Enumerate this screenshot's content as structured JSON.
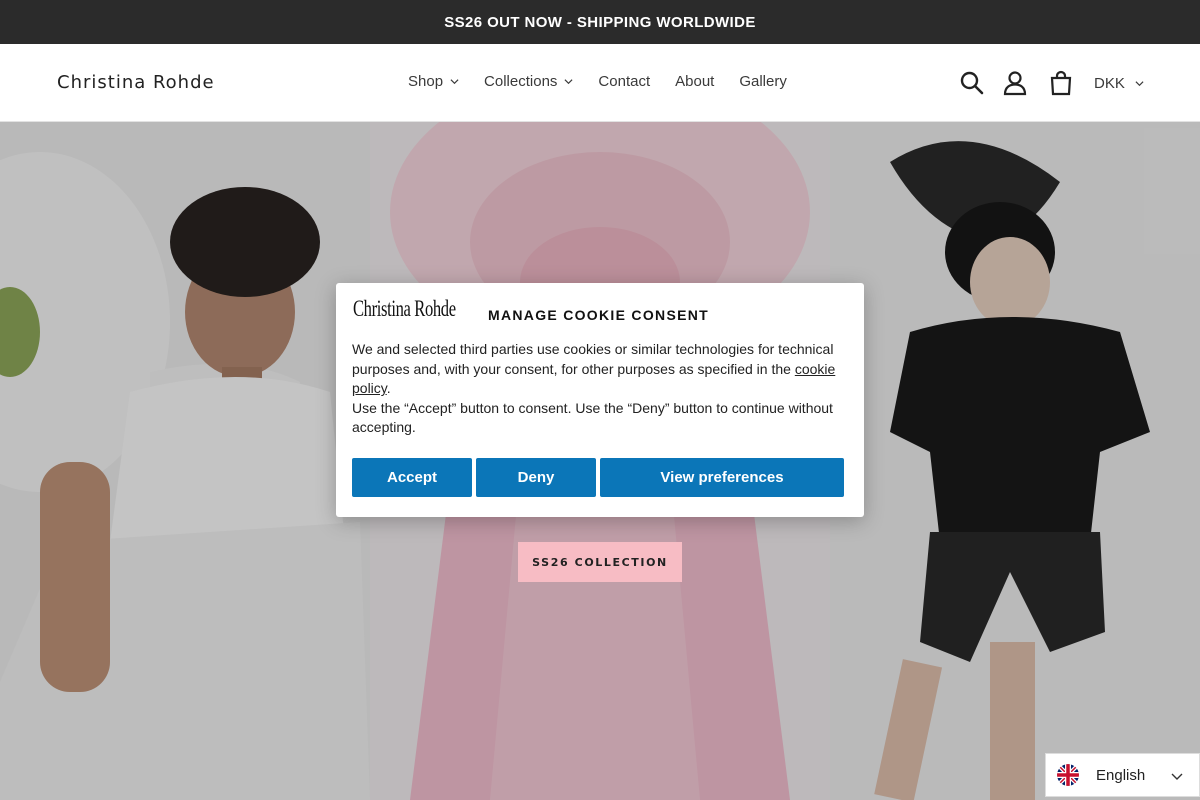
{
  "announcement": "SS26 OUT NOW - SHIPPING WORLDWIDE",
  "header": {
    "logo": "Christina Rohde",
    "nav": [
      {
        "label": "Shop",
        "dropdown": true
      },
      {
        "label": "Collections",
        "dropdown": true
      },
      {
        "label": "Contact",
        "dropdown": false
      },
      {
        "label": "About",
        "dropdown": false
      },
      {
        "label": "Gallery",
        "dropdown": false
      }
    ],
    "icons": [
      "search-icon",
      "account-icon",
      "cart-icon"
    ],
    "currency": "DKK"
  },
  "hero": {
    "cta_label": "SS26 COLLECTION"
  },
  "cookie_modal": {
    "logo": "Christina Rohde",
    "title": "MANAGE COOKIE CONSENT",
    "text_part1": "We and selected third parties use cookies or similar technologies for technical purposes and, with your consent, for other purposes as specified in the ",
    "link_label": "cookie policy",
    "text_part2": ".",
    "text_part3": "Use the “Accept” button to consent. Use the “Deny” button to continue without accepting.",
    "accept_label": "Accept",
    "deny_label": "Deny",
    "preferences_label": "View preferences",
    "button_color": "#0b76b8"
  },
  "language": {
    "label": "English",
    "flag": "uk-flag-icon"
  },
  "colors": {
    "announcement_bg": "#2b2b2b",
    "cta_bg": "#f7bcc4"
  }
}
